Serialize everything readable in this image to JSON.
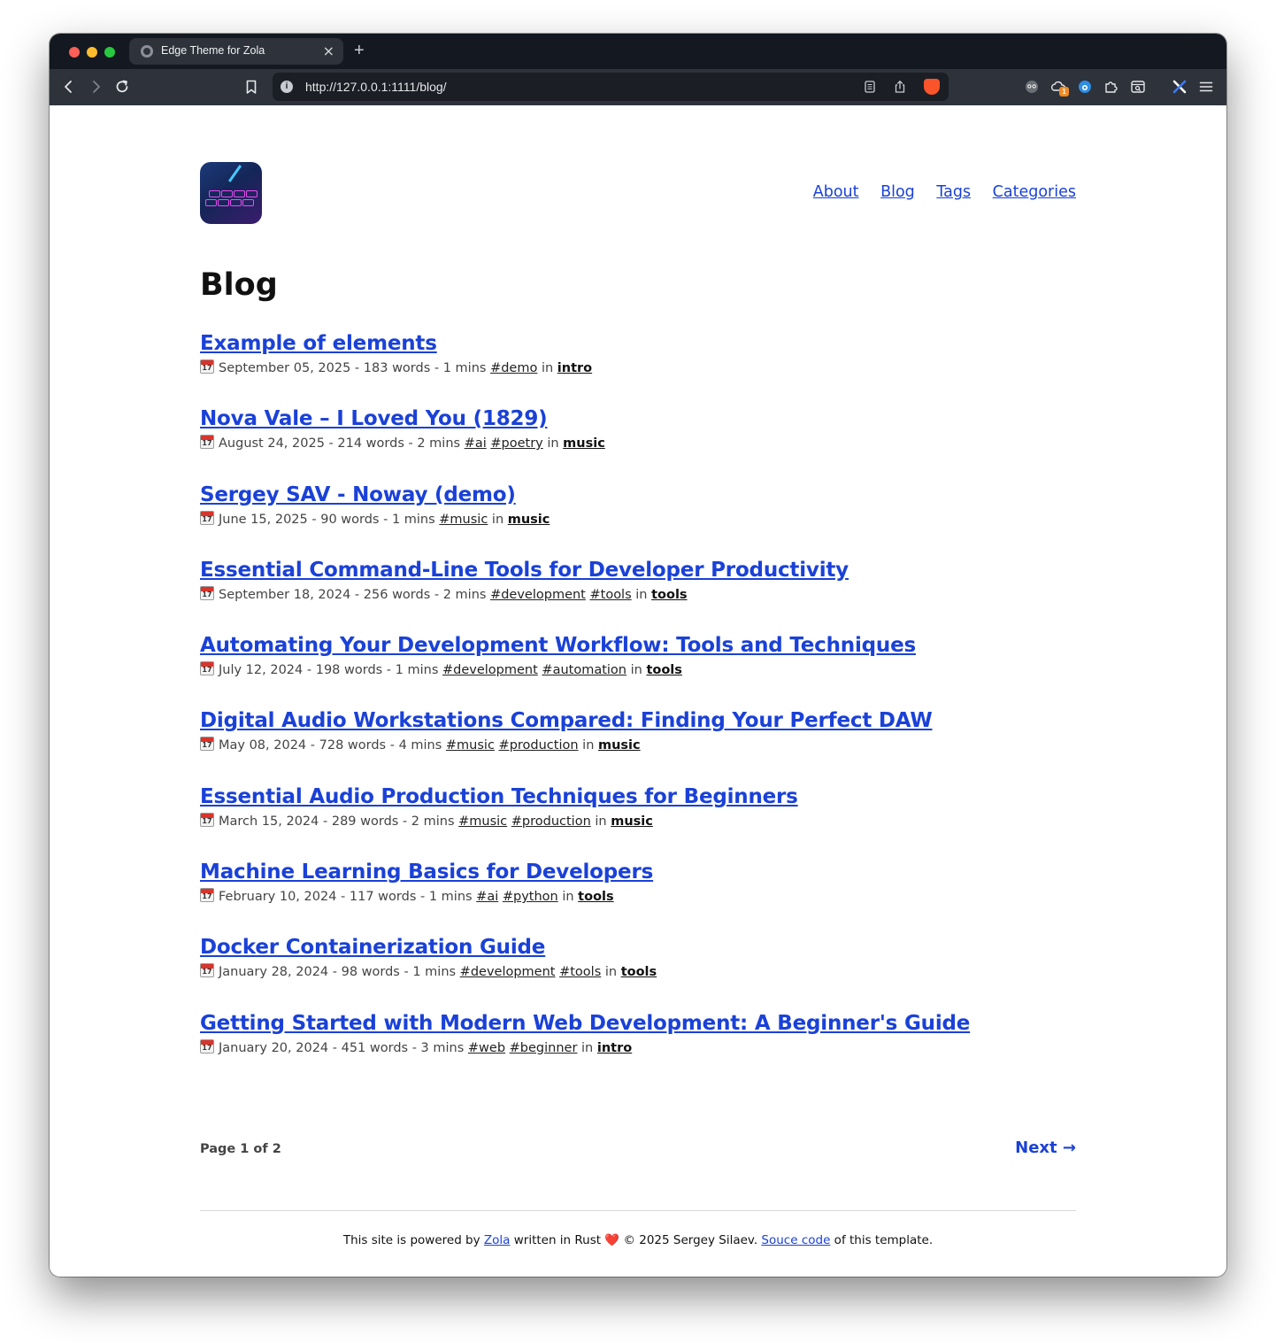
{
  "browser": {
    "tab_title": "Edge Theme for Zola",
    "tab_close": "×",
    "new_tab": "+",
    "url": "http://127.0.0.1:1111/blog/",
    "url_info": "i",
    "extension_badge": "1"
  },
  "site": {
    "nav": [
      {
        "label": "About"
      },
      {
        "label": "Blog"
      },
      {
        "label": "Tags"
      },
      {
        "label": "Categories"
      }
    ],
    "heading": "Blog"
  },
  "posts": [
    {
      "title": "Example of elements",
      "date": "September 05, 2025",
      "words": "183 words",
      "read": "1 mins",
      "tags": [
        "#demo"
      ],
      "category": "intro"
    },
    {
      "title": "Nova Vale – I Loved You (1829)",
      "date": "August 24, 2025",
      "words": "214 words",
      "read": "2 mins",
      "tags": [
        "#ai",
        "#poetry"
      ],
      "category": "music"
    },
    {
      "title": "Sergey SAV - Noway (demo)",
      "date": "June 15, 2025",
      "words": "90 words",
      "read": "1 mins",
      "tags": [
        "#music"
      ],
      "category": "music"
    },
    {
      "title": "Essential Command-Line Tools for Developer Productivity",
      "date": "September 18, 2024",
      "words": "256 words",
      "read": "2 mins",
      "tags": [
        "#development",
        "#tools"
      ],
      "category": "tools"
    },
    {
      "title": "Automating Your Development Workflow: Tools and Techniques",
      "date": "July 12, 2024",
      "words": "198 words",
      "read": "1 mins",
      "tags": [
        "#development",
        "#automation"
      ],
      "category": "tools"
    },
    {
      "title": "Digital Audio Workstations Compared: Finding Your Perfect DAW",
      "date": "May 08, 2024",
      "words": "728 words",
      "read": "4 mins",
      "tags": [
        "#music",
        "#production"
      ],
      "category": "music"
    },
    {
      "title": "Essential Audio Production Techniques for Beginners",
      "date": "March 15, 2024",
      "words": "289 words",
      "read": "2 mins",
      "tags": [
        "#music",
        "#production"
      ],
      "category": "music"
    },
    {
      "title": "Machine Learning Basics for Developers",
      "date": "February 10, 2024",
      "words": "117 words",
      "read": "1 mins",
      "tags": [
        "#ai",
        "#python"
      ],
      "category": "tools"
    },
    {
      "title": "Docker Containerization Guide",
      "date": "January 28, 2024",
      "words": "98 words",
      "read": "1 mins",
      "tags": [
        "#development",
        "#tools"
      ],
      "category": "tools"
    },
    {
      "title": "Getting Started with Modern Web Development: A Beginner's Guide",
      "date": "January 20, 2024",
      "words": "451 words",
      "read": "3 mins",
      "tags": [
        "#web",
        "#beginner"
      ],
      "category": "intro"
    }
  ],
  "meta_words": {
    "sep": " - ",
    "in": "in"
  },
  "pagination": {
    "page_label": "Page 1 of 2",
    "next_label": "Next →"
  },
  "footer": {
    "text_1": "This site is powered by ",
    "link_zola": "Zola",
    "text_2": " written in Rust ",
    "heart": "❤️",
    "text_3": " © 2025 Sergey Silaev. ",
    "link_source": "Souce code",
    "text_4": " of this template."
  },
  "colors": {
    "link": "#1a41d8",
    "tabbar": "#141820",
    "toolbar": "#2e323b",
    "urlbar": "#1b1e25"
  }
}
